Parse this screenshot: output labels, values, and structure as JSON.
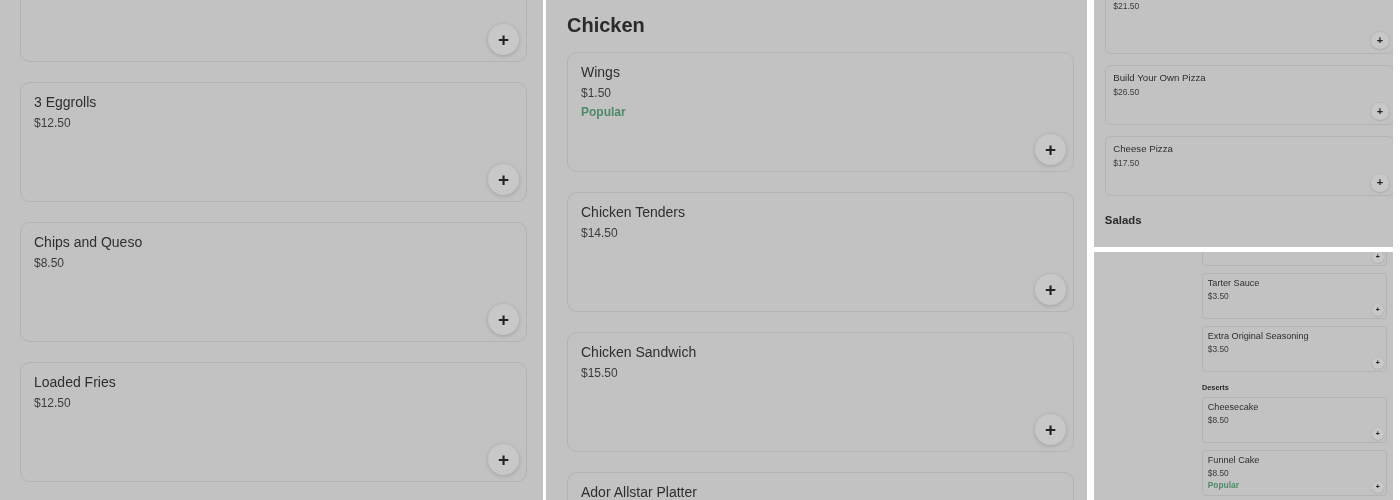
{
  "panels": [
    {
      "sections": [
        {
          "items": [
            {
              "add_label": "+"
            },
            {
              "name": "3 Eggrolls",
              "price": "$12.50",
              "add_label": "+"
            },
            {
              "name": "Chips and Queso",
              "price": "$8.50",
              "add_label": "+"
            },
            {
              "name": "Loaded Fries",
              "price": "$12.50",
              "add_label": "+"
            }
          ]
        }
      ]
    },
    {
      "sections": [
        {
          "heading": "Chicken",
          "items": [
            {
              "name": "Wings",
              "price": "$1.50",
              "badge": "Popular",
              "add_label": "+"
            },
            {
              "name": "Chicken Tenders",
              "price": "$14.50",
              "add_label": "+"
            },
            {
              "name": "Chicken Sandwich",
              "price": "$15.50",
              "add_label": "+"
            },
            {
              "name": "Ador Allstar Platter"
            }
          ]
        }
      ]
    },
    {
      "sections": [
        {
          "items": [
            {
              "price": "$21.50",
              "add_label": "+"
            },
            {
              "name": "Build Your Own Pizza",
              "price": "$26.50",
              "add_label": "+"
            },
            {
              "name": "Cheese Pizza",
              "price": "$17.50",
              "add_label": "+"
            }
          ]
        },
        {
          "heading": "Salads"
        }
      ]
    },
    {
      "sections": [
        {
          "items": [
            {
              "add_label": "+"
            },
            {
              "name": "Tarter Sauce",
              "price": "$3.50",
              "add_label": "+"
            },
            {
              "name": "Extra Original Seasoning",
              "price": "$3.50",
              "add_label": "+"
            }
          ]
        },
        {
          "heading": "Deserts",
          "items": [
            {
              "name": "Cheesecake",
              "price": "$8.50",
              "add_label": "+"
            },
            {
              "name": "Funnel Cake",
              "price": "$8.50",
              "badge": "Popular",
              "add_label": "+"
            }
          ]
        }
      ]
    }
  ]
}
